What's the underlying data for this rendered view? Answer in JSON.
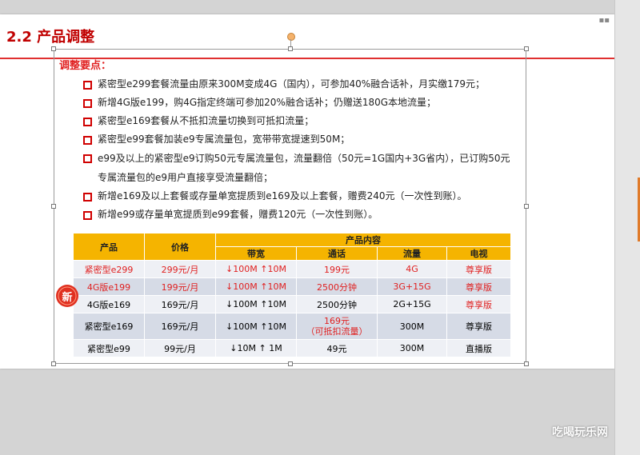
{
  "slide": {
    "title": "2.2 产品调整",
    "heading": "调整要点：",
    "bullets": [
      "紧密型e299套餐流量由原来300M变成4G（国内），可参加40%融合话补，月实缴179元；",
      "新增4G版e199，购4G指定终端可参加20%融合话补；仍赠送180G本地流量；",
      "紧密型e169套餐从不抵扣流量切换到可抵扣流量；",
      "紧密型e99套餐加装e9专属流量包，宽带带宽提速到50M；",
      "e99及以上的紧密型e9订购50元专属流量包，流量翻倍（50元=1G国内+3G省内），已订购50元专属流量包的e9用户直接享受流量翻倍；",
      "新增e169及以上套餐或存量单宽提质到e169及以上套餐，赠费240元（一次性到账）。",
      "新增e99或存量单宽提质到e99套餐，赠费120元（一次性到账）。"
    ],
    "table": {
      "header": {
        "product": "产品",
        "price": "价格",
        "content": "产品内容",
        "bandwidth": "带宽",
        "call": "通话",
        "data": "流量",
        "tv": "电视"
      },
      "rows": [
        {
          "product": "紧密型e299",
          "price": "299元/月",
          "bandwidth": "↓100M ↑10M",
          "call": "199元",
          "data": "4G",
          "tv": "尊享版"
        },
        {
          "product": "4G版e199",
          "price": "199元/月",
          "bandwidth": "↓100M ↑10M",
          "call": "2500分钟",
          "data": "3G+15G",
          "tv": "尊享版"
        },
        {
          "product": "4G版e169",
          "price": "169元/月",
          "bandwidth": "↓100M ↑10M",
          "call": "2500分钟",
          "data": "2G+15G",
          "tv": "尊享版"
        },
        {
          "product": "紧密型e169",
          "price": "169元/月",
          "bandwidth": "↓100M ↑10M",
          "call": "169元\n（可抵扣流量）",
          "data": "300M",
          "tv": "尊享版"
        },
        {
          "product": "紧密型e99",
          "price": "99元/月",
          "bandwidth": "↓10M ↑ 1M",
          "call": "49元",
          "data": "300M",
          "tv": "直播版"
        }
      ]
    },
    "new_badge": "新"
  },
  "watermark": "吃喝玩乐网",
  "colors": {
    "accent": "#e02020",
    "header_bg": "#f5b400",
    "row_light": "#eef0f5",
    "row_dark": "#d6dbe6"
  }
}
